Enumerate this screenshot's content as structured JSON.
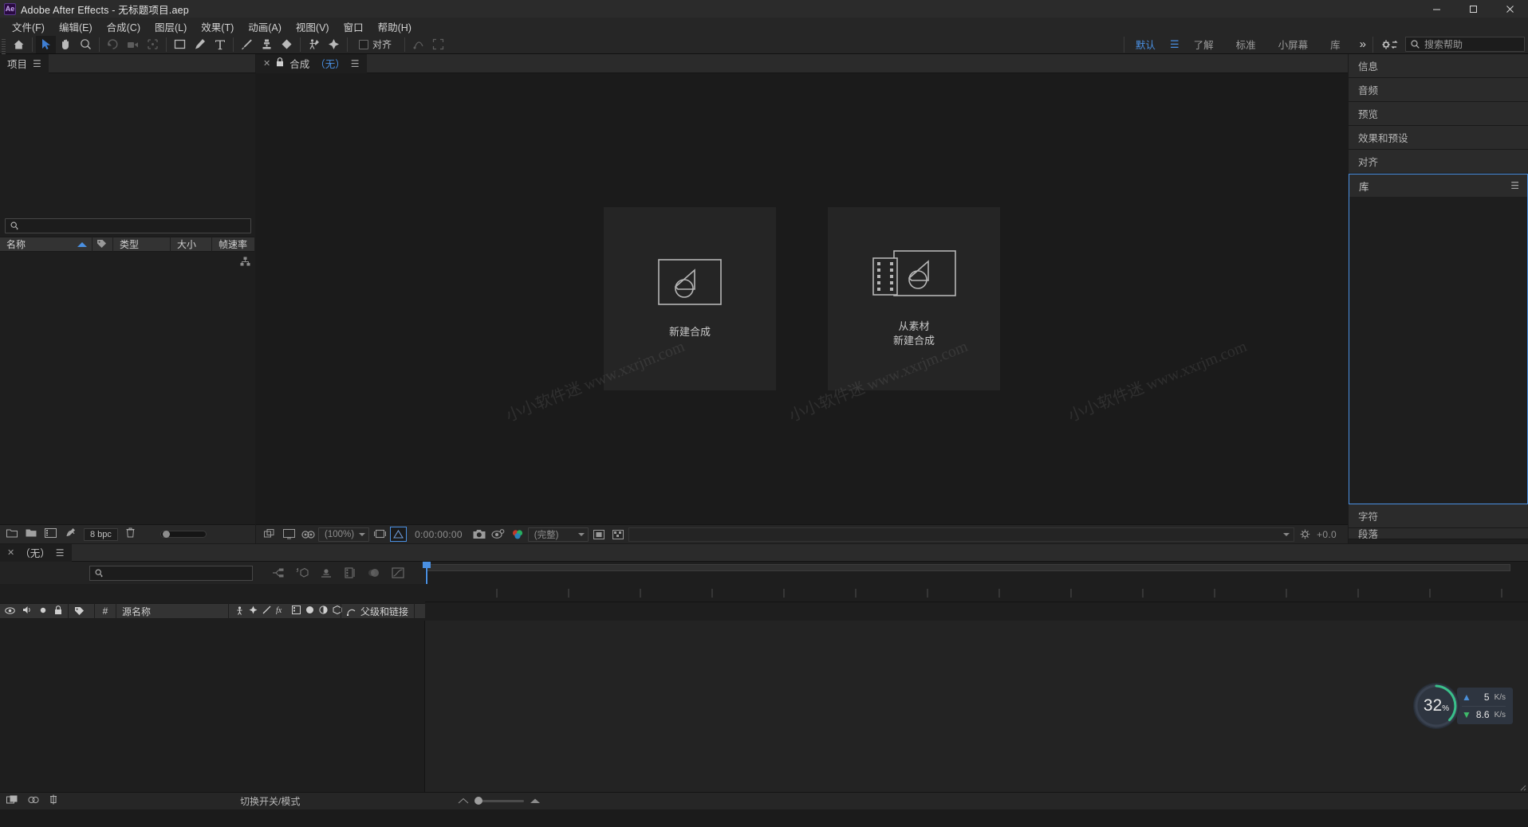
{
  "window": {
    "app_abbrev": "Ae",
    "title": "Adobe After Effects - 无标题项目.aep",
    "controls": {
      "minimize": "minimize-icon",
      "maximize": "maximize-icon",
      "close": "close-icon"
    }
  },
  "menubar": {
    "items": [
      {
        "label": "文件(F)"
      },
      {
        "label": "编辑(E)"
      },
      {
        "label": "合成(C)"
      },
      {
        "label": "图层(L)"
      },
      {
        "label": "效果(T)"
      },
      {
        "label": "动画(A)"
      },
      {
        "label": "视图(V)"
      },
      {
        "label": "窗口"
      },
      {
        "label": "帮助(H)"
      }
    ]
  },
  "toolbar": {
    "snap_label": "对齐",
    "tools": [
      {
        "name": "home-icon"
      },
      {
        "name": "selection-tool-icon"
      },
      {
        "name": "hand-tool-icon"
      },
      {
        "name": "zoom-tool-icon"
      },
      {
        "name": "rotation-tool-icon"
      },
      {
        "name": "camera-tool-icon"
      },
      {
        "name": "pan-behind-tool-icon"
      },
      {
        "name": "shape-tool-icon"
      },
      {
        "name": "pen-tool-icon"
      },
      {
        "name": "type-tool-icon"
      },
      {
        "name": "brush-tool-icon"
      },
      {
        "name": "clone-stamp-tool-icon"
      },
      {
        "name": "eraser-tool-icon"
      },
      {
        "name": "roto-brush-tool-icon"
      },
      {
        "name": "puppet-pin-tool-icon"
      }
    ],
    "workspaces": [
      {
        "label": "默认",
        "selected": true
      },
      {
        "label": "了解",
        "selected": false
      },
      {
        "label": "标准",
        "selected": false
      },
      {
        "label": "小屏幕",
        "selected": false
      },
      {
        "label": "库",
        "selected": false
      }
    ],
    "more_label": "»",
    "search_placeholder": "搜索帮助"
  },
  "project_panel": {
    "tab_label": "项目",
    "search_value": "",
    "columns": [
      {
        "label": "名称",
        "sorted": true
      },
      {
        "label": "",
        "icon": "tag-icon"
      },
      {
        "label": "类型"
      },
      {
        "label": "大小"
      },
      {
        "label": "帧速率"
      }
    ],
    "footer": {
      "bit_depth": "8 bpc",
      "icons": [
        "new-folder-icon",
        "folder-icon",
        "project-settings-icon",
        "interpret-footage-icon",
        "delete-icon"
      ]
    }
  },
  "composition_panel": {
    "tab_prefix": "合成",
    "tab_value": "（无）",
    "lock_icon": "lock-icon",
    "close_icon": "close-icon",
    "cards": [
      {
        "icon": "new-composition-icon",
        "label": "新建合成"
      },
      {
        "icon": "composition-from-footage-icon",
        "label": "从素材\n新建合成"
      }
    ],
    "bottom_bar": {
      "zoom": "(100%)",
      "timecode": "0:00:00:00",
      "resolution": "(完整)",
      "exposure": "+0.0"
    },
    "watermarks": [
      "小小软件迷 www.xxrjm.com",
      "小小软件迷 www.xxrjm.com",
      "小小软件迷 www.xxrjm.com"
    ]
  },
  "right_dock": {
    "collapsed_top": [
      {
        "label": "信息"
      },
      {
        "label": "音频"
      },
      {
        "label": "预览"
      },
      {
        "label": "效果和预设"
      },
      {
        "label": "对齐"
      }
    ],
    "open_panel": {
      "label": "库"
    },
    "collapsed_bottom": [
      {
        "label": "字符"
      },
      {
        "label": "段落"
      }
    ]
  },
  "timeline_panel": {
    "tab_label": "（无）",
    "close_icon": "close-icon",
    "search_value": "",
    "toolbar_icons": [
      "composition-mini-flowchart-icon",
      "draft-3d-icon",
      "hide-shy-layers-icon",
      "frame-blending-icon",
      "motion-blur-icon",
      "graph-editor-icon"
    ],
    "columns": {
      "video_icon": "eye-icon",
      "audio_icon": "speaker-icon",
      "solo_icon": "solo-icon",
      "lock_icon": "lock-icon",
      "label_icon": "tag-icon",
      "index": "#",
      "source_name": "源名称",
      "switches": [
        "shy-icon",
        "collapse-icon",
        "quality-icon",
        "fx-icon",
        "frame-blend-icon",
        "motion-blur-icon",
        "adjustment-icon",
        "three-d-icon"
      ],
      "parent": "父级和链接"
    },
    "footer_label": "切换开关/模式"
  },
  "download_widget": {
    "percent": "32",
    "percent_unit": "%",
    "upload_rate": "5",
    "upload_unit": "K/s",
    "download_rate": "8.6",
    "download_unit": "K/s",
    "ring_color": "#39c08a",
    "panel_color": "#2e3540"
  }
}
